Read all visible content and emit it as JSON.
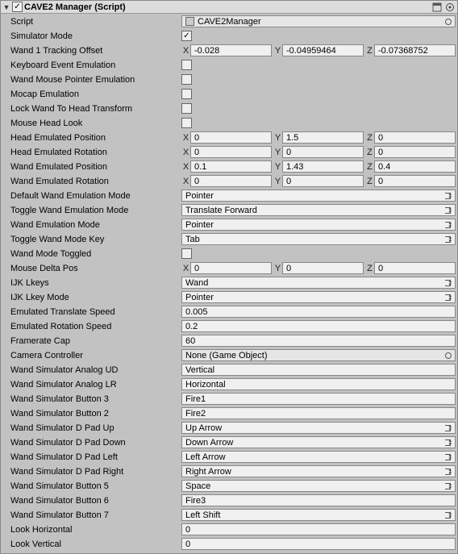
{
  "header": {
    "title": "CAVE2 Manager (Script)",
    "enabled_check": "✓"
  },
  "script": {
    "label": "Script",
    "value": "CAVE2Manager"
  },
  "props": {
    "simulatorMode": {
      "label": "Simulator Mode",
      "checked": "✓"
    },
    "wand1Offset": {
      "label": "Wand 1 Tracking Offset",
      "x": "-0.028",
      "y": "-0.04959464",
      "z": "-0.07368752"
    },
    "kbEventEmu": {
      "label": "Keyboard Event Emulation",
      "checked": ""
    },
    "wandMousePtr": {
      "label": "Wand Mouse Pointer Emulation",
      "checked": ""
    },
    "mocapEmu": {
      "label": "Mocap Emulation",
      "checked": ""
    },
    "lockWandHead": {
      "label": "Lock Wand To Head Transform",
      "checked": ""
    },
    "mouseHeadLook": {
      "label": "Mouse Head Look",
      "checked": ""
    },
    "headEmuPos": {
      "label": "Head Emulated Position",
      "x": "0",
      "y": "1.5",
      "z": "0"
    },
    "headEmuRot": {
      "label": "Head Emulated Rotation",
      "x": "0",
      "y": "0",
      "z": "0"
    },
    "wandEmuPos": {
      "label": "Wand Emulated Position",
      "x": "0.1",
      "y": "1.43",
      "z": "0.4"
    },
    "wandEmuRot": {
      "label": "Wand Emulated Rotation",
      "x": "0",
      "y": "0",
      "z": "0"
    },
    "defWandEmuMode": {
      "label": "Default Wand Emulation Mode",
      "value": "Pointer"
    },
    "toggleWandEmuMode": {
      "label": "Toggle Wand Emulation Mode",
      "value": "Translate Forward"
    },
    "wandEmuMode": {
      "label": "Wand Emulation Mode",
      "value": "Pointer"
    },
    "toggleWandModeKey": {
      "label": "Toggle Wand Mode Key",
      "value": "Tab"
    },
    "wandModeToggled": {
      "label": "Wand Mode Toggled",
      "checked": ""
    },
    "mouseDeltaPos": {
      "label": "Mouse Delta Pos",
      "x": "0",
      "y": "0",
      "z": "0"
    },
    "ijkLkeys": {
      "label": "IJK Lkeys",
      "value": "Wand"
    },
    "ijkLkeyMode": {
      "label": "IJK Lkey Mode",
      "value": "Pointer"
    },
    "emuTransSpeed": {
      "label": "Emulated Translate Speed",
      "value": "0.005"
    },
    "emuRotSpeed": {
      "label": "Emulated Rotation Speed",
      "value": "0.2"
    },
    "framerateCap": {
      "label": "Framerate Cap",
      "value": "60"
    },
    "cameraController": {
      "label": "Camera Controller",
      "value": "None (Game Object)"
    },
    "wandSimAnalogUD": {
      "label": "Wand Simulator Analog UD",
      "value": "Vertical"
    },
    "wandSimAnalogLR": {
      "label": "Wand Simulator Analog LR",
      "value": "Horizontal"
    },
    "wandSimBtn3": {
      "label": "Wand Simulator Button 3",
      "value": "Fire1"
    },
    "wandSimBtn2": {
      "label": "Wand Simulator Button 2",
      "value": "Fire2"
    },
    "wandSimDPadUp": {
      "label": "Wand Simulator D Pad Up",
      "value": "Up Arrow"
    },
    "wandSimDPadDown": {
      "label": "Wand Simulator D Pad Down",
      "value": "Down Arrow"
    },
    "wandSimDPadLeft": {
      "label": "Wand Simulator D Pad Left",
      "value": "Left Arrow"
    },
    "wandSimDPadRight": {
      "label": "Wand Simulator D Pad Right",
      "value": "Right Arrow"
    },
    "wandSimBtn5": {
      "label": "Wand Simulator Button 5",
      "value": "Space"
    },
    "wandSimBtn6": {
      "label": "Wand Simulator Button 6",
      "value": "Fire3"
    },
    "wandSimBtn7": {
      "label": "Wand Simulator Button 7",
      "value": "Left Shift"
    },
    "lookHorizontal": {
      "label": "Look Horizontal",
      "value": "0"
    },
    "lookVertical": {
      "label": "Look Vertical",
      "value": "0"
    }
  },
  "axis": {
    "x": "X",
    "y": "Y",
    "z": "Z"
  }
}
